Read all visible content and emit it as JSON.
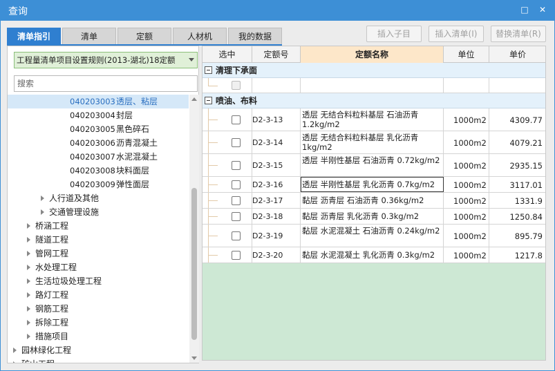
{
  "window": {
    "title": "查询",
    "max_glyph": "□",
    "close_glyph": "✕"
  },
  "tabs": [
    {
      "label": "清单指引"
    },
    {
      "label": "清单"
    },
    {
      "label": "定额"
    },
    {
      "label": "人材机"
    },
    {
      "label": "我的数据"
    }
  ],
  "actions": {
    "insert_child": "插入子目",
    "insert_bill": "插入清单(I)",
    "replace_bill": "替换清单(R)"
  },
  "rule_dropdown": "工程量清单项目设置规则(2013-湖北)18定额",
  "search": {
    "placeholder": "搜索",
    "value": ""
  },
  "tree": [
    {
      "code": "040203003",
      "name": "透层、粘层",
      "selected": true
    },
    {
      "code": "040203004",
      "name": "封层"
    },
    {
      "code": "040203005",
      "name": "黑色碎石"
    },
    {
      "code": "040203006",
      "name": "沥青混凝土"
    },
    {
      "code": "040203007",
      "name": "水泥混凝土"
    },
    {
      "code": "040203008",
      "name": "块料面层"
    },
    {
      "code": "040203009",
      "name": "弹性面层"
    },
    {
      "name": "人行道及其他",
      "level": 2
    },
    {
      "name": "交通管理设施",
      "level": 2
    },
    {
      "name": "桥涵工程",
      "level": 1
    },
    {
      "name": "隧道工程",
      "level": 1
    },
    {
      "name": "管网工程",
      "level": 1
    },
    {
      "name": "水处理工程",
      "level": 1
    },
    {
      "name": "生活垃圾处理工程",
      "level": 1
    },
    {
      "name": "路灯工程",
      "level": 1
    },
    {
      "name": "钢筋工程",
      "level": 1
    },
    {
      "name": "拆除工程",
      "level": 1
    },
    {
      "name": "措施项目",
      "level": 1
    },
    {
      "name": "园林绿化工程",
      "level": 0
    },
    {
      "name": "矿山工程",
      "level": 0
    }
  ],
  "grid": {
    "columns": [
      "选中",
      "定额号",
      "定额名称",
      "单位",
      "单价"
    ],
    "groups": [
      {
        "label": "清理下承面",
        "rows": []
      },
      {
        "label": "喷油、布料",
        "rows": [
          {
            "code": "D2-3-13",
            "name": "透层 无结合料粒料基层 石油沥青 1.2kg/m2",
            "unit": "1000m2",
            "price": "4309.77"
          },
          {
            "code": "D2-3-14",
            "name": "透层 无结合料粒料基层 乳化沥青 1kg/m2",
            "unit": "1000m2",
            "price": "4079.21"
          },
          {
            "code": "D2-3-15",
            "name": "透层 半刚性基层 石油沥青 0.72kg/m2",
            "unit": "1000m2",
            "price": "2935.15"
          },
          {
            "code": "D2-3-16",
            "name": "透层 半刚性基层 乳化沥青 0.7kg/m2",
            "unit": "1000m2",
            "price": "3117.01",
            "focus": true
          },
          {
            "code": "D2-3-17",
            "name": "黏层 沥青层 石油沥青 0.36kg/m2",
            "unit": "1000m2",
            "price": "1331.9"
          },
          {
            "code": "D2-3-18",
            "name": "黏层 沥青层 乳化沥青 0.3kg/m2",
            "unit": "1000m2",
            "price": "1250.84"
          },
          {
            "code": "D2-3-19",
            "name": "黏层 水泥混凝土 石油沥青 0.24kg/m2",
            "unit": "1000m2",
            "price": "895.79"
          },
          {
            "code": "D2-3-20",
            "name": "黏层 水泥混凝土 乳化沥青 0.3kg/m2",
            "unit": "1000m2",
            "price": "1217.8"
          }
        ]
      }
    ]
  }
}
